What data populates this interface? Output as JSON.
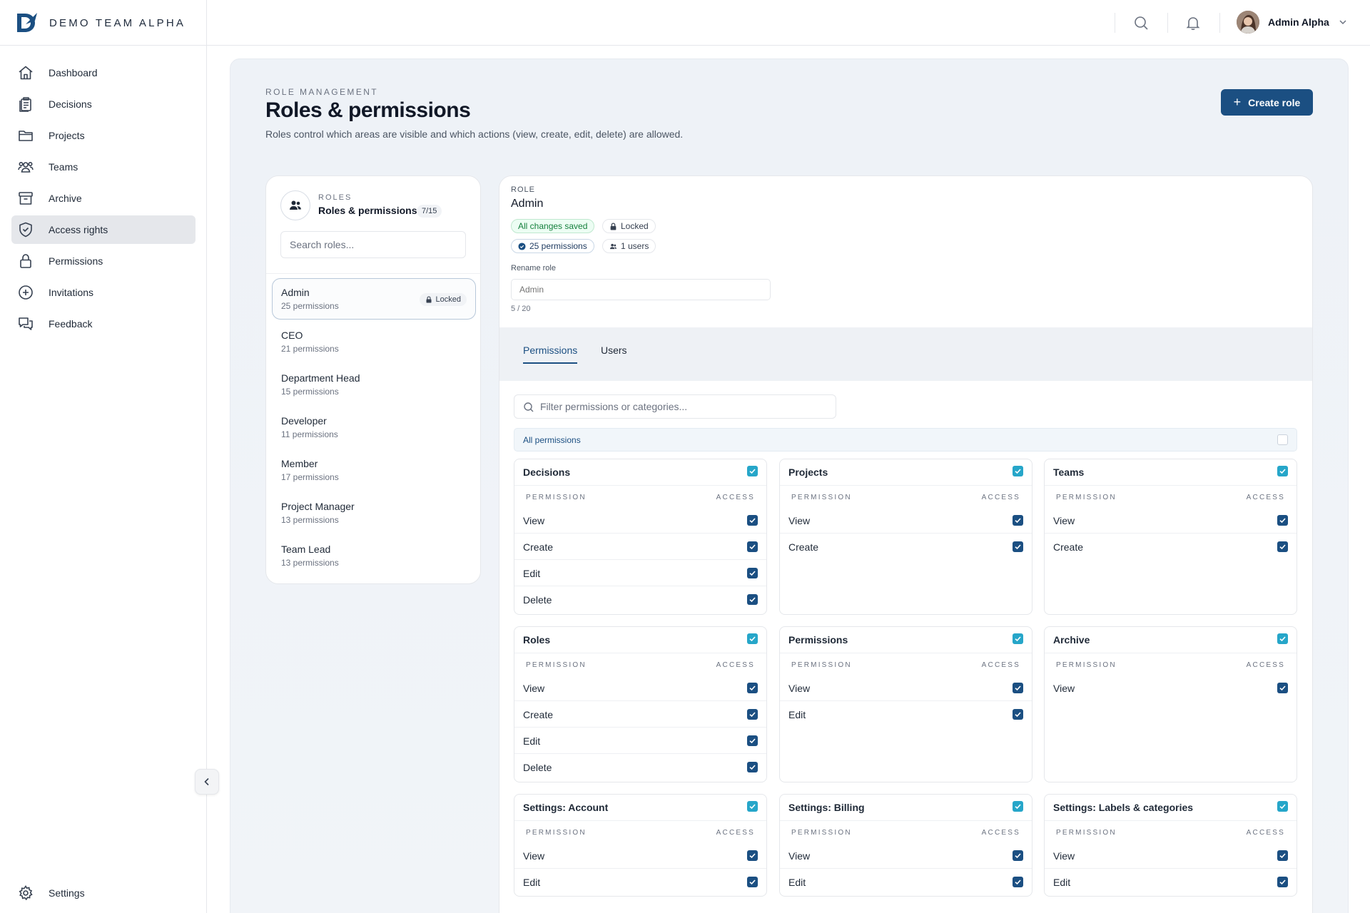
{
  "brand": {
    "name": "DEMO TEAM ALPHA"
  },
  "header": {
    "user_name": "Admin Alpha"
  },
  "sidebar": {
    "items": [
      {
        "label": "Dashboard",
        "icon": "home-icon",
        "active": false
      },
      {
        "label": "Decisions",
        "icon": "clipboard-icon",
        "active": false
      },
      {
        "label": "Projects",
        "icon": "folder-icon",
        "active": false
      },
      {
        "label": "Teams",
        "icon": "users-icon",
        "active": false
      },
      {
        "label": "Archive",
        "icon": "archive-box-icon",
        "active": false
      },
      {
        "label": "Access rights",
        "icon": "shield-check-icon",
        "active": true
      },
      {
        "label": "Permissions",
        "icon": "lock-icon",
        "active": false
      },
      {
        "label": "Invitations",
        "icon": "plus-circle-icon",
        "active": false
      },
      {
        "label": "Feedback",
        "icon": "chat-bubbles-icon",
        "active": false
      }
    ],
    "settings_label": "Settings"
  },
  "page": {
    "eyebrow": "ROLE MANAGEMENT",
    "title": "Roles & permissions",
    "description": "Roles control which areas are visible and which actions (view, create, edit, delete) are allowed.",
    "create_button": "Create role"
  },
  "roles_panel": {
    "eyebrow": "ROLES",
    "title": "Roles & permissions",
    "count": "7/15",
    "search_placeholder": "Search roles...",
    "locked_label": "Locked",
    "roles": [
      {
        "name": "Admin",
        "permissions": "25 permissions",
        "selected": true,
        "locked": true
      },
      {
        "name": "CEO",
        "permissions": "21 permissions",
        "selected": false,
        "locked": false
      },
      {
        "name": "Department Head",
        "permissions": "15 permissions",
        "selected": false,
        "locked": false
      },
      {
        "name": "Developer",
        "permissions": "11 permissions",
        "selected": false,
        "locked": false
      },
      {
        "name": "Member",
        "permissions": "17 permissions",
        "selected": false,
        "locked": false
      },
      {
        "name": "Project Manager",
        "permissions": "13 permissions",
        "selected": false,
        "locked": false
      },
      {
        "name": "Team Lead",
        "permissions": "13 permissions",
        "selected": false,
        "locked": false
      }
    ]
  },
  "detail": {
    "eyebrow": "ROLE",
    "title": "Admin",
    "saved_chip": "All changes saved",
    "locked_chip": "Locked",
    "permissions_chip": "25 permissions",
    "users_chip": "1 users",
    "rename_label": "Rename role",
    "rename_placeholder": "Admin",
    "rename_count": "5 / 20",
    "tabs": [
      {
        "label": "Permissions",
        "active": true
      },
      {
        "label": "Users",
        "active": false
      }
    ],
    "filter_placeholder": "Filter permissions or categories...",
    "all_permissions_label": "All permissions",
    "all_permissions_checked": false,
    "col_permission": "PERMISSION",
    "col_access": "ACCESS",
    "groups": [
      {
        "title": "Decisions",
        "checked": true,
        "rows": [
          {
            "label": "View",
            "checked": true
          },
          {
            "label": "Create",
            "checked": true
          },
          {
            "label": "Edit",
            "checked": true
          },
          {
            "label": "Delete",
            "checked": true
          }
        ]
      },
      {
        "title": "Projects",
        "checked": true,
        "rows": [
          {
            "label": "View",
            "checked": true
          },
          {
            "label": "Create",
            "checked": true
          }
        ]
      },
      {
        "title": "Teams",
        "checked": true,
        "rows": [
          {
            "label": "View",
            "checked": true
          },
          {
            "label": "Create",
            "checked": true
          }
        ]
      },
      {
        "title": "Roles",
        "checked": true,
        "rows": [
          {
            "label": "View",
            "checked": true
          },
          {
            "label": "Create",
            "checked": true
          },
          {
            "label": "Edit",
            "checked": true
          },
          {
            "label": "Delete",
            "checked": true
          }
        ]
      },
      {
        "title": "Permissions",
        "checked": true,
        "rows": [
          {
            "label": "View",
            "checked": true
          },
          {
            "label": "Edit",
            "checked": true
          }
        ]
      },
      {
        "title": "Archive",
        "checked": true,
        "rows": [
          {
            "label": "View",
            "checked": true
          }
        ]
      },
      {
        "title": "Settings: Account",
        "checked": true,
        "rows": [
          {
            "label": "View",
            "checked": true
          },
          {
            "label": "Edit",
            "checked": true
          }
        ]
      },
      {
        "title": "Settings: Billing",
        "checked": true,
        "rows": [
          {
            "label": "View",
            "checked": true
          },
          {
            "label": "Edit",
            "checked": true
          }
        ]
      },
      {
        "title": "Settings: Labels & categories",
        "checked": true,
        "rows": [
          {
            "label": "View",
            "checked": true
          },
          {
            "label": "Edit",
            "checked": true
          }
        ]
      }
    ]
  },
  "colors": {
    "accent": "#1b4f82",
    "group_check": "#26a6c9",
    "saved_green": "#15803d",
    "active_nav": "#e5e7eb"
  }
}
